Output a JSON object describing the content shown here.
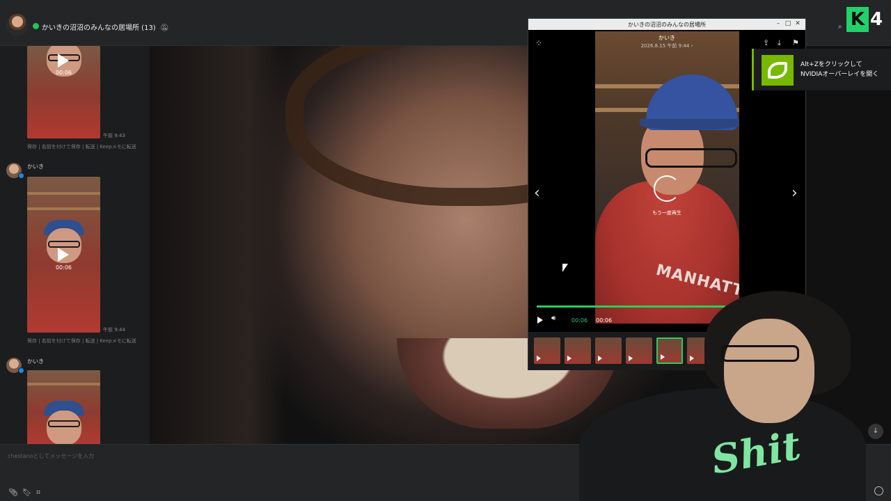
{
  "chat": {
    "title": "かいきの沼沼のみんなの居場所 (13)",
    "mute_icon": "bell-slash-icon",
    "search_icon": "search-icon"
  },
  "messages": [
    {
      "sender": "",
      "duration": "00:06",
      "time": "午前 9:43",
      "actions": "保存 | 名前を付けて保存 | 転送 | Keepメモに転送"
    },
    {
      "sender": "かいき",
      "duration": "00:06",
      "time": "午前 9:44",
      "actions": "保存 | 名前を付けて保存 | 転送 | Keepメモに転送"
    },
    {
      "sender": "かいき",
      "duration": "",
      "time": "",
      "actions": ""
    }
  ],
  "input": {
    "placeholder": "chestanoとしてメッセージを入力",
    "icons": [
      "paperclip-icon",
      "bookmark-icon",
      "crop-icon",
      "emoji-icon"
    ]
  },
  "viewer": {
    "window_title": "かいきの沼沼のみんなの居場所",
    "sender": "かいき",
    "date": "2026.8.15 午前 9:44 ›",
    "replay_label": "もう一度再生",
    "time_current": "00:06",
    "time_total": "00:06",
    "progress_fraction": 1.0,
    "thumbnail_count": 7,
    "active_thumbnail": 4,
    "accent": "#2dcc5c",
    "icons": [
      "grid-icon",
      "share-icon",
      "download-icon",
      "bookmark-icon",
      "prev-arrow-icon",
      "next-arrow-icon",
      "play-icon",
      "volume-icon",
      "replay-icon"
    ]
  },
  "nvidia": {
    "line1": "Alt+Zをクリックして",
    "line2": "NVIDIAオーバーレイを開く",
    "brand_color": "#76b900"
  },
  "brand": {
    "logo_k": "K",
    "logo_num": "4"
  },
  "stream": {
    "cam_shirt_text": "Shit",
    "video_shirt_text": "MANHATT"
  }
}
